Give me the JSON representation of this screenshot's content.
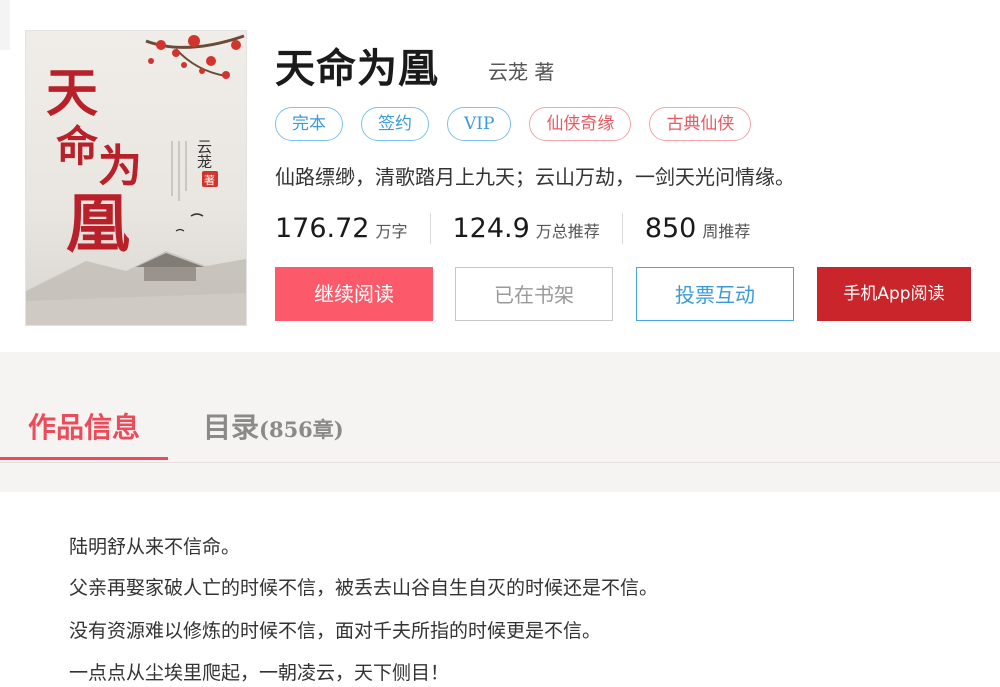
{
  "book": {
    "title": "天命为凰",
    "author": "云茏 著",
    "tags": [
      {
        "label": "完本",
        "color": "blue"
      },
      {
        "label": "签约",
        "color": "blue"
      },
      {
        "label": "VIP",
        "color": "blue"
      },
      {
        "label": "仙侠奇缘",
        "color": "red"
      },
      {
        "label": "古典仙侠",
        "color": "red"
      }
    ],
    "intro": "仙路缥缈，清歌踏月上九天；云山万劫，一剑天光问情缘。",
    "stats": [
      {
        "value": "176.72",
        "unit": "万字"
      },
      {
        "value": "124.9",
        "unit": "万总推荐"
      },
      {
        "value": "850",
        "unit": "周推荐"
      }
    ],
    "cover": {
      "title_chars": [
        "天",
        "命",
        "为",
        "凰"
      ],
      "author_vertical": "云茏",
      "seal": "著"
    }
  },
  "actions": {
    "continue_reading": "继续阅读",
    "on_shelf": "已在书架",
    "vote": "投票互动",
    "app_read": "手机App阅读"
  },
  "tabs": {
    "info": "作品信息",
    "catalog": "目录",
    "catalog_count": "(856章)"
  },
  "description": [
    "陆明舒从来不信命。",
    "父亲再娶家破人亡的时候不信，被丢去山谷自生自灭的时候还是不信。",
    "没有资源难以修炼的时候不信，面对千夫所指的时候更是不信。",
    "一点点从尘埃里爬起，一朝凌云，天下侧目！"
  ],
  "colors": {
    "accent_red": "#fc5a6a",
    "app_red": "#c9252a",
    "blue": "#3b9ad8",
    "tab_red": "#ec4c5a"
  }
}
